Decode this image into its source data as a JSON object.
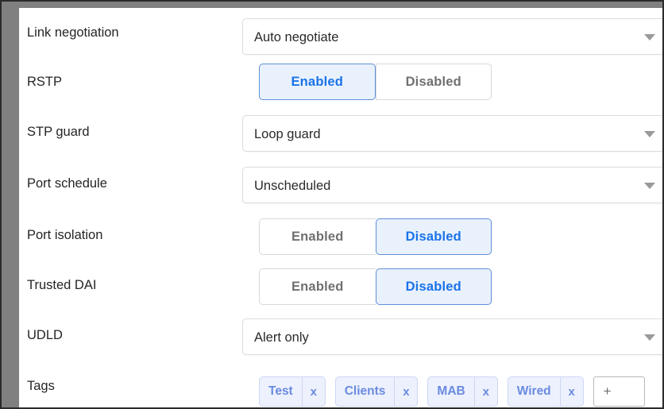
{
  "panel": {
    "rows": [
      {
        "label": "Link negotiation",
        "control": "select",
        "value": "Auto negotiate",
        "arrow_icon": "chevron-down-icon"
      },
      {
        "label": "RSTP",
        "control": "segmented",
        "options": [
          "Enabled",
          "Disabled"
        ],
        "selected": "Enabled"
      },
      {
        "label": "STP guard",
        "control": "select",
        "value": "Loop guard",
        "arrow_icon": "chevron-down-icon"
      },
      {
        "label": "Port schedule",
        "control": "select",
        "value": "Unscheduled",
        "arrow_icon": "chevron-down-icon"
      },
      {
        "label": "Port isolation",
        "control": "segmented",
        "options": [
          "Enabled",
          "Disabled"
        ],
        "selected": "Disabled"
      },
      {
        "label": "Trusted DAI",
        "control": "segmented",
        "options": [
          "Enabled",
          "Disabled"
        ],
        "selected": "Disabled"
      },
      {
        "label": "UDLD",
        "control": "select",
        "value": "Alert only",
        "arrow_icon": "chevron-down-icon"
      },
      {
        "label": "Tags",
        "control": "tags",
        "tags": [
          "Test",
          "Clients",
          "MAB",
          "Wired"
        ],
        "remove_label": "x",
        "add_placeholder": "+"
      }
    ]
  },
  "colors": {
    "accent_blue": "#1a73e8",
    "selected_fill": "#e9f1fd",
    "selected_border": "#5e8fd6",
    "tag_text": "#6a8be0",
    "tag_fill": "#edf1fd",
    "tag_border": "#ccd7f5",
    "control_border": "#dcdcdc",
    "unselected_text": "#707070",
    "label_text": "#252525",
    "chrome_gray": "#808080",
    "frame_dark": "#2b2b2b"
  }
}
